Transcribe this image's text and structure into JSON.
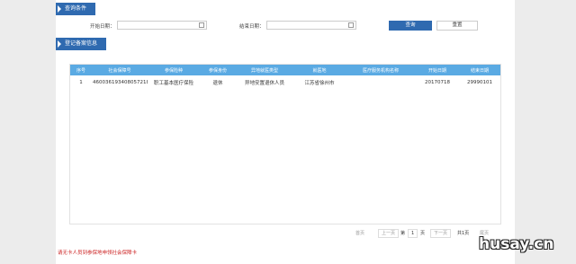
{
  "query_section": {
    "title": "查询条件",
    "start_date_label": "开始日期：",
    "start_date_value": "",
    "end_date_label": "结束日期：",
    "end_date_value": "",
    "query_button": "查询",
    "reset_button": "重置"
  },
  "record_section": {
    "title": "登记备案信息"
  },
  "table": {
    "headers": [
      "序号",
      "社会保障号",
      "参保险种",
      "参保身份",
      "异地就医类型",
      "就医地",
      "医疗服务机构名称",
      "开始日期",
      "结束日期"
    ],
    "rows": [
      [
        "1",
        "460036193408057218",
        "职工基本医疗保险",
        "退休",
        "异地安置退休人员",
        "江苏省徐州市",
        "",
        "20170718",
        "29990101"
      ]
    ]
  },
  "pager": {
    "first": "首页",
    "prev": "上一页",
    "page_prefix": "第",
    "page_number": "1",
    "page_suffix": "页",
    "next": "下一页",
    "total": "共1页",
    "last": "尾页"
  },
  "notice": "请无卡人员到参保地申领社会保障卡",
  "watermark": "husay.cn",
  "colors": {
    "accent": "#2f6ab0",
    "table_header": "#5aaae3",
    "notice": "#cc2222"
  }
}
